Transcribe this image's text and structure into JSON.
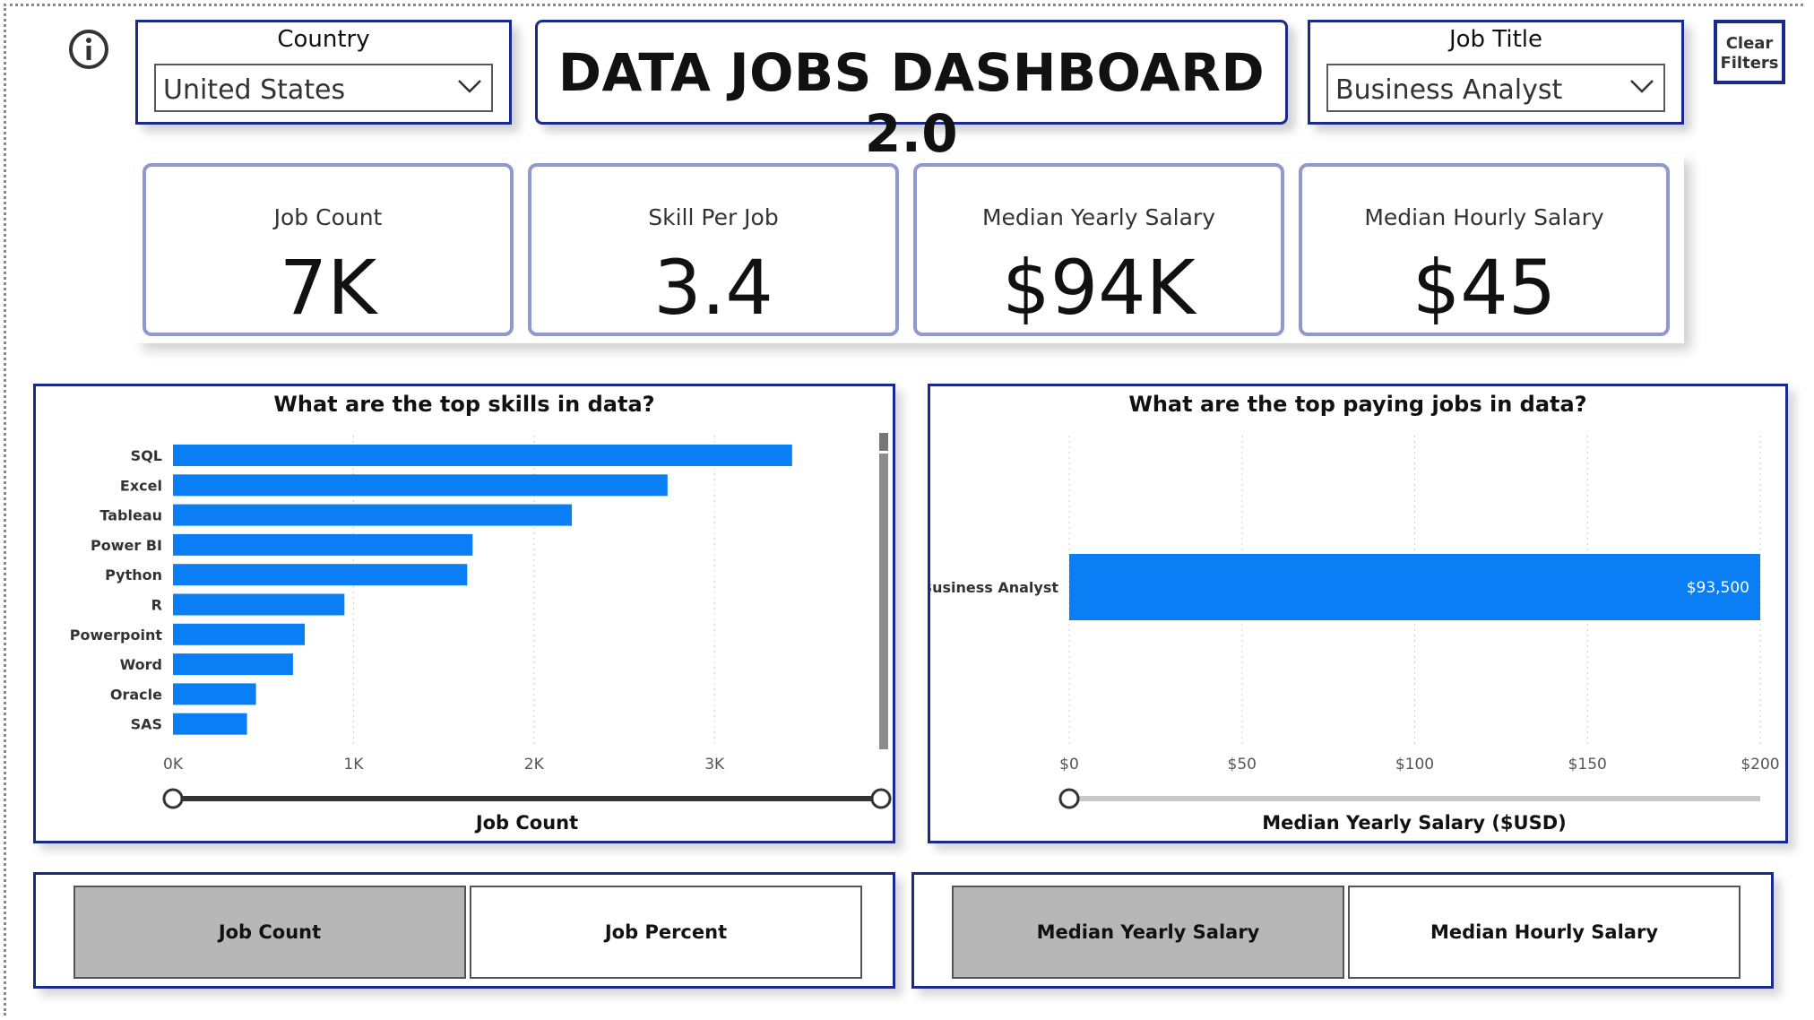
{
  "header": {
    "title": "DATA JOBS DASHBOARD 2.0",
    "country_slicer": {
      "label": "Country",
      "value": "United States"
    },
    "job_title_slicer": {
      "label": "Job Title",
      "value": "Business Analyst"
    },
    "clear_filters": {
      "line1": "Clear",
      "line2": "Filters"
    },
    "info_icon": "info-icon"
  },
  "kpis": [
    {
      "label": "Job Count",
      "value": "7K"
    },
    {
      "label": "Skill Per Job",
      "value": "3.4"
    },
    {
      "label": "Median Yearly Salary",
      "value": "$94K"
    },
    {
      "label": "Median Hourly Salary",
      "value": "$45"
    }
  ],
  "toggles_left": {
    "buttons": [
      "Job Count",
      "Job Percent"
    ],
    "active": 0
  },
  "toggles_right": {
    "buttons": [
      "Median Yearly Salary",
      "Median Hourly Salary"
    ],
    "active": 0
  },
  "colors": {
    "bar": "#0a7ff5",
    "navy": "#1a2a8c",
    "kpi_border": "#8f98cf",
    "active_toggle": "#b7b7b7"
  },
  "chart_data": [
    {
      "type": "bar",
      "orientation": "horizontal",
      "title": "What are the top skills in data?",
      "xlabel": "Job Count",
      "ylabel": "",
      "categories": [
        "SQL",
        "Excel",
        "Tableau",
        "Power BI",
        "Python",
        "R",
        "Powerpoint",
        "Word",
        "Oracle",
        "SAS"
      ],
      "values": [
        3430,
        2740,
        2210,
        1660,
        1630,
        950,
        730,
        665,
        460,
        410
      ],
      "xlim": [
        0,
        3580
      ],
      "xticks": [
        0,
        1000,
        2000,
        3000
      ],
      "xtick_labels": [
        "0K",
        "1K",
        "2K",
        "3K"
      ],
      "grid": true,
      "legend": "none"
    },
    {
      "type": "bar",
      "orientation": "horizontal",
      "title": "What are the top paying jobs in data?",
      "xlabel": "Median Yearly Salary ($USD)",
      "ylabel": "",
      "categories": [
        "Business Analyst"
      ],
      "values": [
        93500
      ],
      "value_labels": [
        "$93,500"
      ],
      "xlim": [
        0,
        200
      ],
      "xticks": [
        0,
        50,
        100,
        150,
        200
      ],
      "xtick_labels": [
        "$0",
        "$50",
        "$100",
        "$150",
        "$200"
      ],
      "grid": true,
      "legend": "none"
    }
  ]
}
